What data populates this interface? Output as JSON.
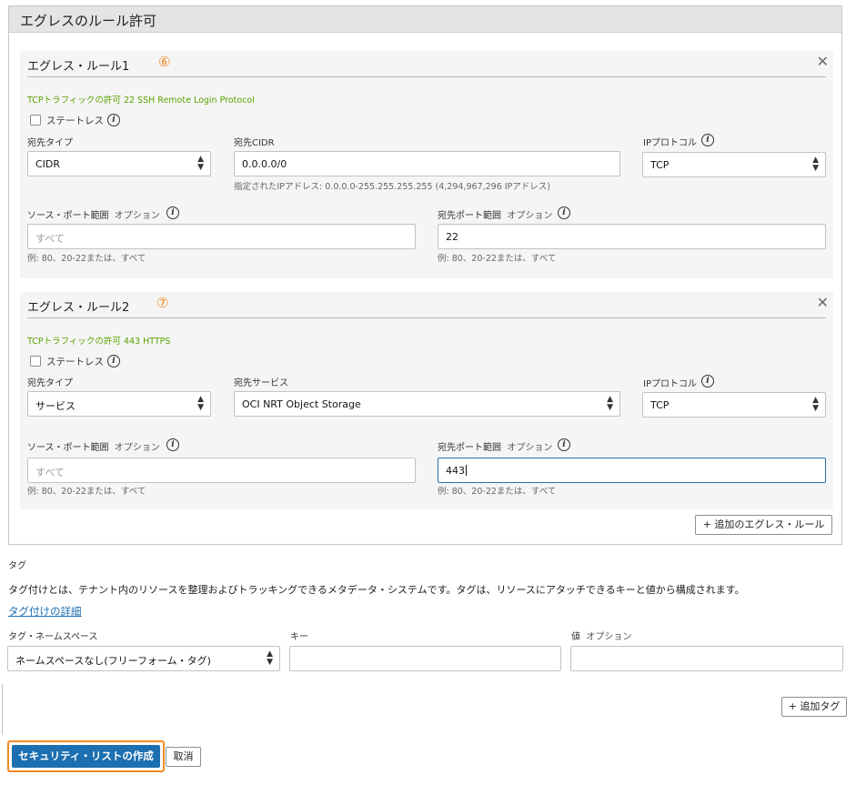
{
  "egress": {
    "title": "エグレスのルール許可",
    "add_rule_label": "+ 追加のエグレス・ルール",
    "rules": [
      {
        "title": "エグレス・ルール1",
        "step": "⑥",
        "description": "TCPトラフィックの許可 22 SSH Remote Login Protocol",
        "stateless_label": "ステートレス",
        "dest_type_label": "宛先タイプ",
        "dest_type_value": "CIDR",
        "dest_label": "宛先CIDR",
        "dest_value": "0.0.0.0/0",
        "dest_hint": "指定されたIPアドレス: 0.0.0.0-255.255.255.255 (4,294,967,296 IPアドレス)",
        "protocol_label": "IPプロトコル",
        "protocol_value": "TCP",
        "src_port_label": "ソース・ポート範囲",
        "src_port_optional": "オプション",
        "src_port_placeholder": "すべて",
        "src_port_hint": "例: 80、20-22または、すべて",
        "dst_port_label": "宛先ポート範囲",
        "dst_port_optional": "オプション",
        "dst_port_value": "22",
        "dst_port_hint": "例: 80、20-22または、すべて"
      },
      {
        "title": "エグレス・ルール2",
        "step": "⑦",
        "description": "TCPトラフィックの許可 443 HTTPS",
        "stateless_label": "ステートレス",
        "dest_type_label": "宛先タイプ",
        "dest_type_value": "サービス",
        "dest_label": "宛先サービス",
        "dest_value": "OCI NRT Object Storage",
        "protocol_label": "IPプロトコル",
        "protocol_value": "TCP",
        "src_port_label": "ソース・ポート範囲",
        "src_port_optional": "オプション",
        "src_port_placeholder": "すべて",
        "src_port_hint": "例: 80、20-22または、すべて",
        "dst_port_label": "宛先ポート範囲",
        "dst_port_optional": "オプション",
        "dst_port_value": "443",
        "dst_port_hint": "例: 80、20-22または、すべて"
      }
    ]
  },
  "tags": {
    "title": "タグ",
    "description": "タグ付けとは、テナント内のリソースを整理およびトラッキングできるメタデータ・システムです。タグは、リソースにアタッチできるキーと値から構成されます。",
    "link": "タグ付けの詳細",
    "namespace_label": "タグ・ネームスペース",
    "namespace_value": "ネームスペースなし(フリーフォーム・タグ)",
    "key_label": "キー",
    "value_label": "値",
    "value_optional": "オプション",
    "add_tag_label": "+ 追加タグ"
  },
  "footer": {
    "create_label": "セキュリティ・リストの作成",
    "cancel_label": "取消"
  },
  "colors": {
    "primary": "#1c6fb0",
    "highlight": "#f08a24",
    "description_green": "#5aa300"
  }
}
